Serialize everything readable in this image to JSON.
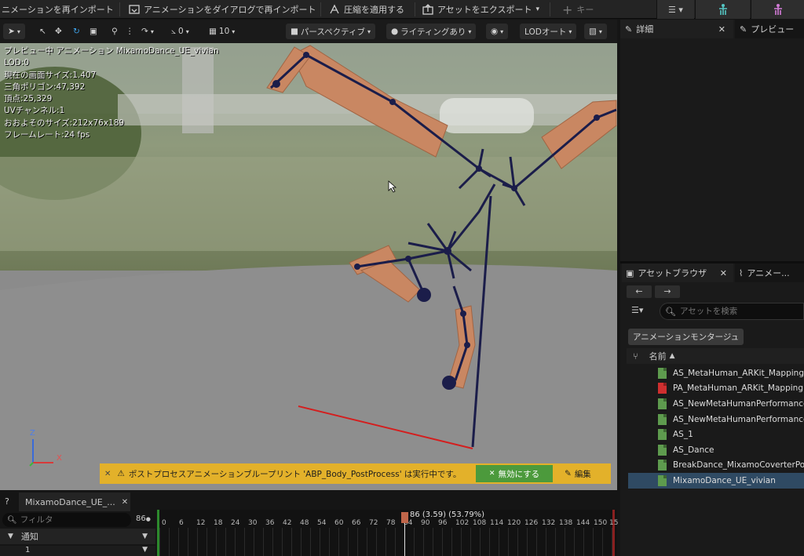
{
  "topbar": {
    "reimport_anim": "ニメーションを再インポート",
    "reimport_dialog": "アニメーションをダイアログで再インポート",
    "apply_compression": "圧縮を適用する",
    "export_asset": "アセットをエクスポート",
    "key": "キー"
  },
  "viewport_toolbar": {
    "angle_snap": "0",
    "scale_snap": "10",
    "perspective": "パースペクティブ",
    "lighting": "ライティングあり",
    "lod": "LODオート"
  },
  "stats": [
    "プレビュー中 アニメーション MixamoDance_UE_vivian",
    "LOD:0",
    "現在の画面サイズ:1.407",
    "三角ポリゴン:47,392",
    "頂点:25,329",
    "UVチャンネル:1",
    "おおよそのサイズ:212x76x189",
    "フレームレート:24 fps"
  ],
  "notice": {
    "text": "ポストプロセスアニメーションブループリント 'ABP_Body_PostProcess' は実行中です。",
    "disable": "無効にする",
    "edit": "編集"
  },
  "axis": {
    "x": "X",
    "z": "Z"
  },
  "right_panel": {
    "details_tab": "詳細",
    "preview_tab": "プレビュー",
    "asset_browser_tab": "アセットブラウザ",
    "anim_tab": "アニメー...",
    "search_placeholder": "アセットを検索",
    "filter_chip": "アニメーションモンタージュ",
    "name_header": "名前",
    "assets": [
      {
        "name": "AS_MetaHuman_ARKit_Mapping",
        "color": "#5e9b4e"
      },
      {
        "name": "PA_MetaHuman_ARKit_Mapping",
        "color": "#cf2f2f"
      },
      {
        "name": "AS_NewMetaHumanPerformance",
        "color": "#5e9b4e"
      },
      {
        "name": "AS_NewMetaHumanPerformance",
        "color": "#5e9b4e"
      },
      {
        "name": "AS_1",
        "color": "#5e9b4e"
      },
      {
        "name": "AS_Dance",
        "color": "#5e9b4e"
      },
      {
        "name": "BreakDance_MixamoCoverterPostu",
        "color": "#5e9b4e"
      },
      {
        "name": "MixamoDance_UE_vivian",
        "color": "#5e9b4e"
      }
    ]
  },
  "timeline": {
    "tab_label": "MixamoDance_UE_...",
    "filter_placeholder": "フィルタ",
    "frame": "86",
    "playhead_label": "86 (3.59) (53.79%)",
    "notify_track": "通知",
    "track_1": "1",
    "ticks": [
      "0",
      "6",
      "12",
      "18",
      "24",
      "30",
      "36",
      "42",
      "48",
      "54",
      "60",
      "66",
      "72",
      "78",
      "84",
      "90",
      "96",
      "102",
      "108",
      "114",
      "120",
      "126",
      "132",
      "138",
      "144",
      "150",
      "15"
    ]
  },
  "colors": {
    "accent_green": "#4c9a3c",
    "notice_yellow": "#e3b12a",
    "selected_row": "#2f4a63"
  }
}
